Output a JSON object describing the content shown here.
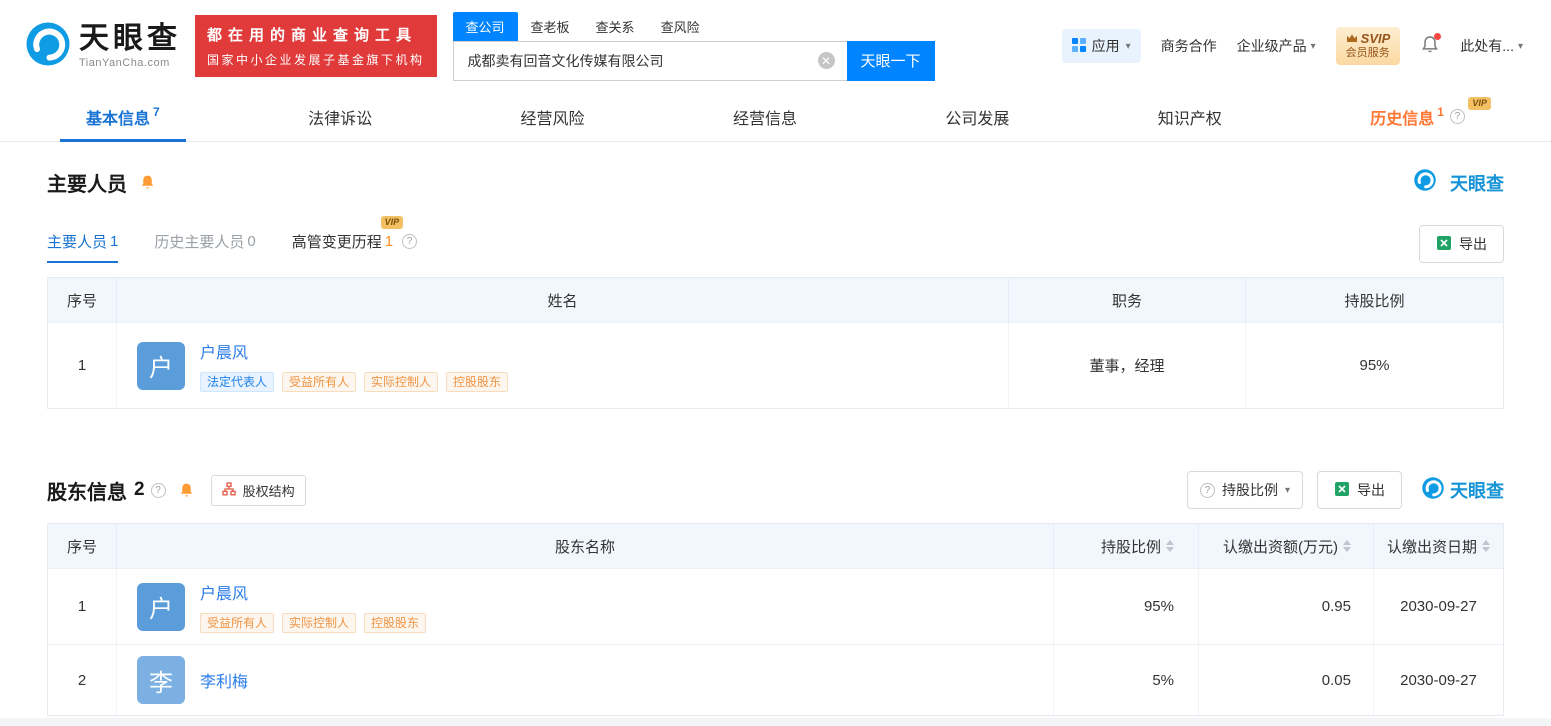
{
  "colors": {
    "brand_blue": "#0084ff",
    "banner_red": "#e03a3a",
    "link_blue": "#2b7ce9",
    "tag_orange": "#ef9443",
    "vip_gold": "#f3c163"
  },
  "vip_label": "VIP",
  "watermark": "天眼查",
  "header": {
    "logo": {
      "name": "天眼查",
      "domain": "TianYanCha.com"
    },
    "banner": {
      "line1": "都在用的商业查询工具",
      "line2": "国家中小企业发展子基金旗下机构"
    },
    "search": {
      "tabs": [
        {
          "label": "查公司",
          "active": true
        },
        {
          "label": "查老板",
          "active": false
        },
        {
          "label": "查关系",
          "active": false
        },
        {
          "label": "查风险",
          "active": false
        }
      ],
      "value": "成都卖有回音文化传媒有限公司",
      "button_label": "天眼一下"
    },
    "apps_label": "应用",
    "links": {
      "business": "商务合作",
      "enterprise": "企业级产品"
    },
    "vip": {
      "line1": "SVIP",
      "line2": "会员服务"
    },
    "user_label": "此处有..."
  },
  "nav": {
    "tabs": [
      {
        "label": "基本信息",
        "count": "7"
      },
      {
        "label": "法律诉讼"
      },
      {
        "label": "经营风险"
      },
      {
        "label": "经营信息"
      },
      {
        "label": "公司发展"
      },
      {
        "label": "知识产权"
      },
      {
        "label": "历史信息",
        "count": "1"
      }
    ]
  },
  "personnel": {
    "title": "主要人员",
    "tabs": [
      {
        "label": "主要人员",
        "count": "1"
      },
      {
        "label": "历史主要人员",
        "count": "0"
      },
      {
        "label": "高管变更历程",
        "count": "1"
      }
    ],
    "export_label": "导出",
    "table": {
      "headers": [
        "序号",
        "姓名",
        "职务",
        "持股比例"
      ],
      "rows": [
        {
          "index": "1",
          "name": "户晨风",
          "avatar": "户",
          "tags": [
            {
              "label": "法定代表人",
              "type": "blue"
            },
            {
              "label": "受益所有人",
              "type": "orange"
            },
            {
              "label": "实际控制人",
              "type": "orange"
            },
            {
              "label": "控股股东",
              "type": "orange"
            }
          ],
          "position": "董事，经理",
          "ratio": "95%"
        }
      ]
    }
  },
  "shareholders": {
    "title": "股东信息",
    "count": "2",
    "structure_label": "股权结构",
    "sort_label": "持股比例",
    "export_label": "导出",
    "table": {
      "headers": [
        "序号",
        "股东名称",
        "持股比例",
        "认缴出资额(万元)",
        "认缴出资日期"
      ],
      "rows": [
        {
          "index": "1",
          "name": "户晨风",
          "avatar": "户",
          "tags": [
            {
              "label": "受益所有人",
              "type": "orange"
            },
            {
              "label": "实际控制人",
              "type": "orange"
            },
            {
              "label": "控股股东",
              "type": "orange"
            }
          ],
          "ratio": "95%",
          "amount": "0.95",
          "date": "2030-09-27"
        },
        {
          "index": "2",
          "name": "李利梅",
          "avatar": "李",
          "ratio": "5%",
          "amount": "0.05",
          "date": "2030-09-27"
        }
      ]
    }
  }
}
